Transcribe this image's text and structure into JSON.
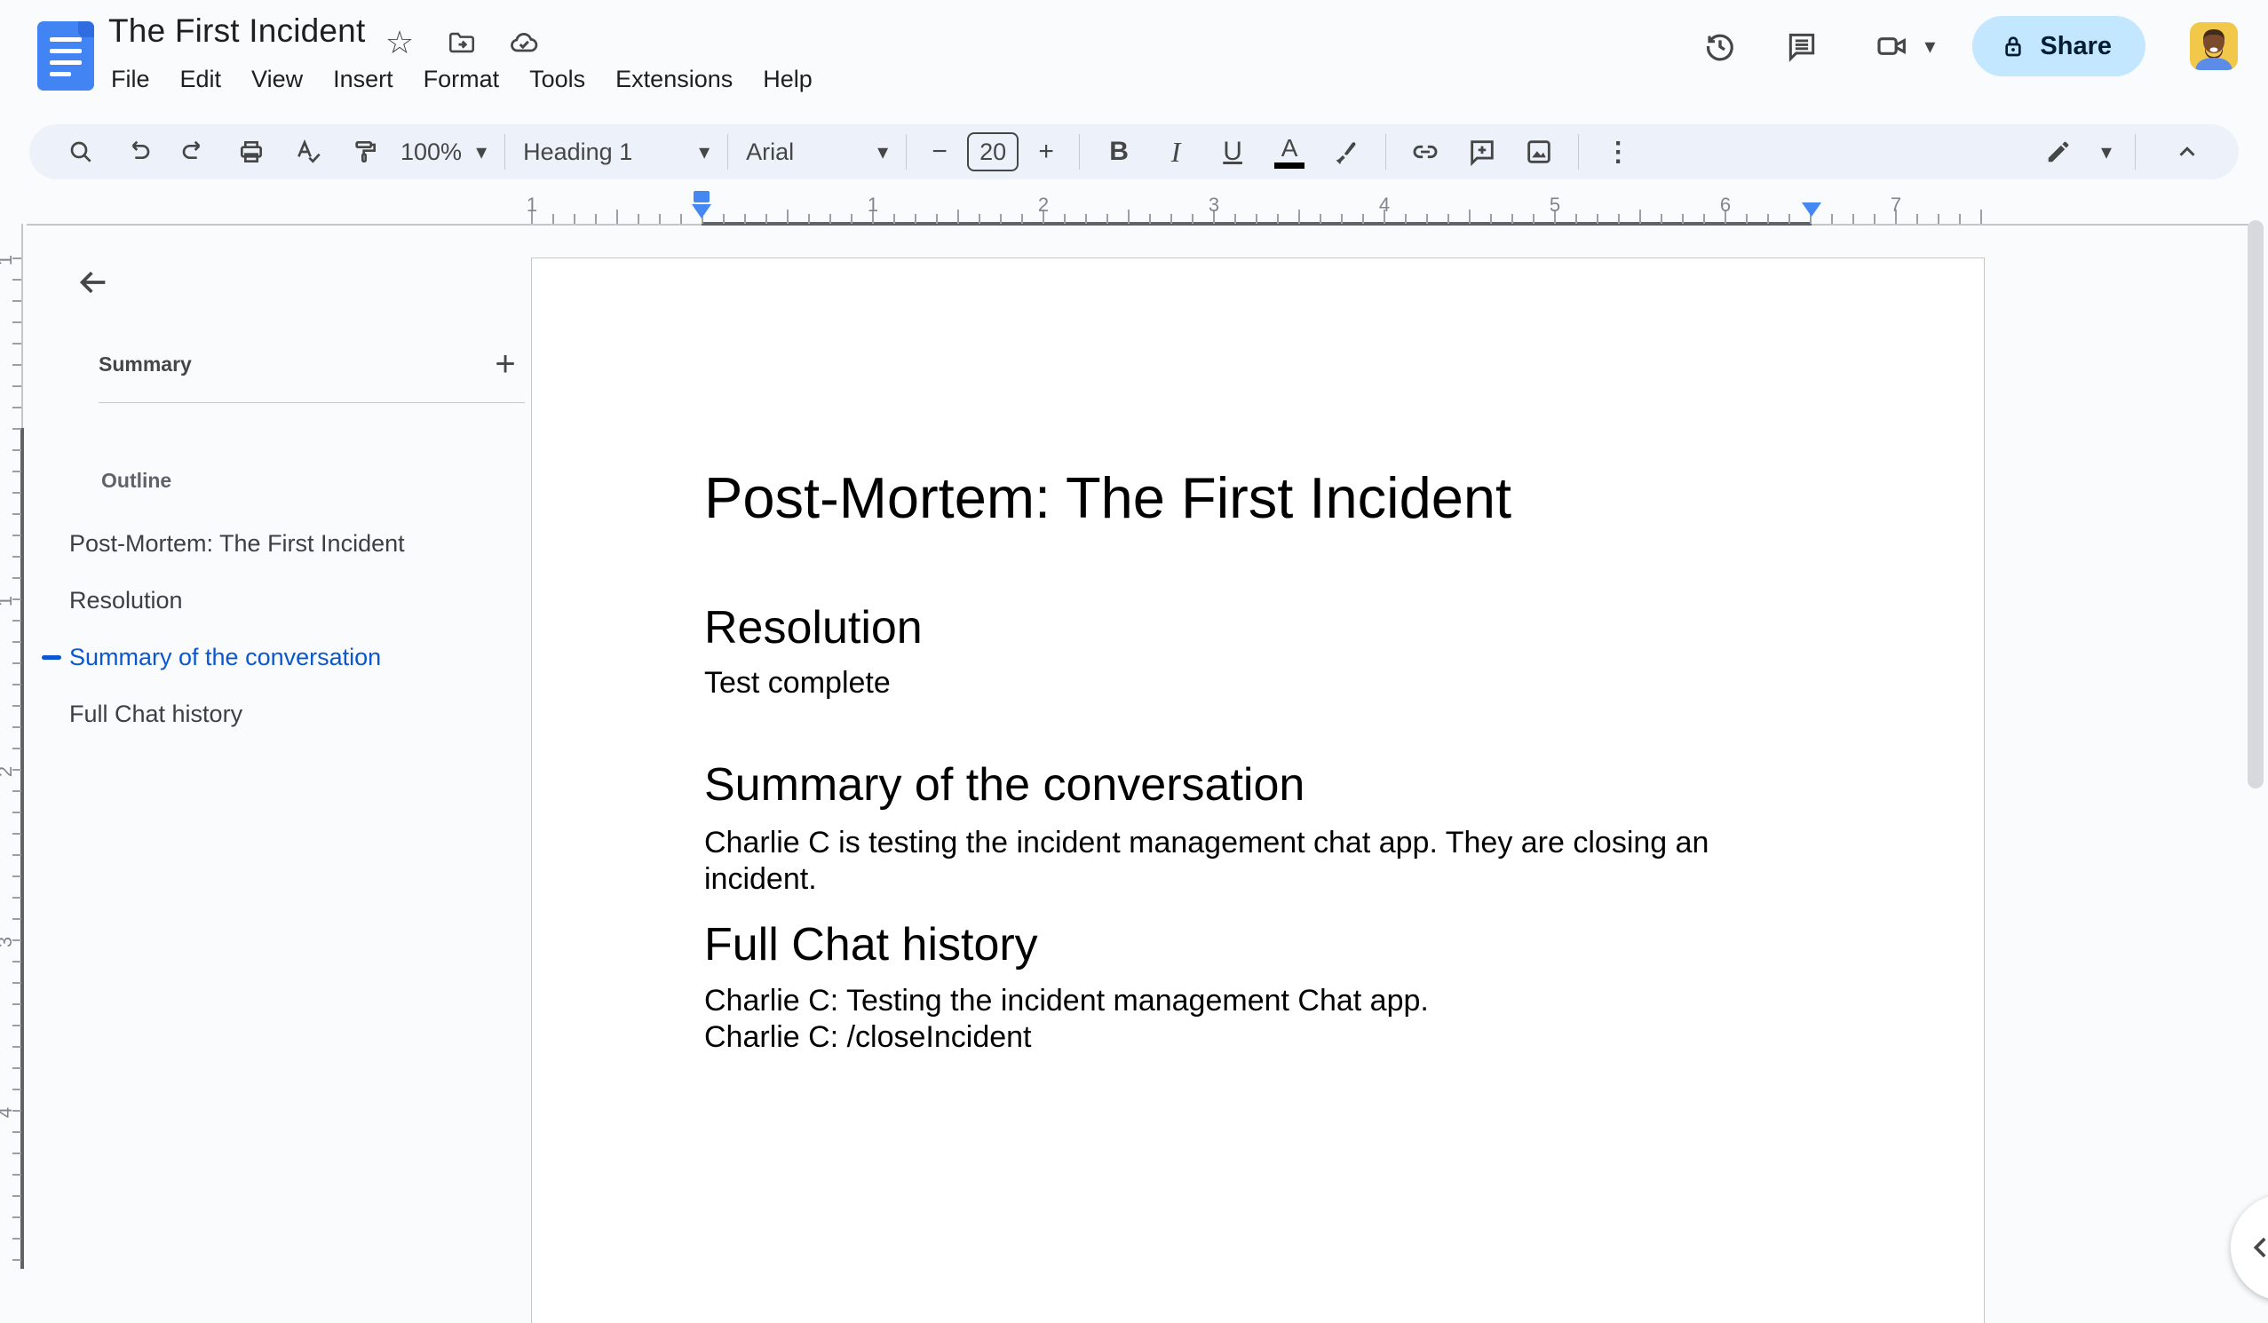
{
  "header": {
    "doc_title": "The First Incident",
    "menus": [
      "File",
      "Edit",
      "View",
      "Insert",
      "Format",
      "Tools",
      "Extensions",
      "Help"
    ],
    "share_label": "Share"
  },
  "toolbar": {
    "zoom_value": "100%",
    "style_value": "Heading 1",
    "font_value": "Arial",
    "font_size_value": "20"
  },
  "glyphs": {
    "caret": "▾",
    "star": "☆",
    "plus": "+",
    "minus": "−",
    "bold": "B",
    "italic": "I",
    "underline": "U",
    "text_color": "A",
    "more_vertical": "⋮"
  },
  "icons": [
    "docs-logo",
    "star-icon",
    "move-folder-icon",
    "cloud-check-icon",
    "history-icon",
    "comments-icon",
    "video-call-icon",
    "lock-icon",
    "search-icon",
    "undo-icon",
    "redo-icon",
    "print-icon",
    "spellcheck-icon",
    "paint-format-icon",
    "link-icon",
    "add-comment-icon",
    "insert-image-icon",
    "edit-mode-pencil-icon",
    "collapse-menus-icon",
    "back-arrow-icon",
    "chevron-left-icon"
  ],
  "sidebar": {
    "summary_label": "Summary",
    "outline_label": "Outline",
    "items": [
      {
        "label": "Post-Mortem: The First Incident",
        "active": false
      },
      {
        "label": "Resolution",
        "active": false
      },
      {
        "label": "Summary of the conversation",
        "active": true
      },
      {
        "label": "Full Chat history",
        "active": false
      }
    ]
  },
  "ruler": {
    "h_labels": [
      "1",
      "1",
      "2",
      "3",
      "4",
      "5",
      "6",
      "7"
    ],
    "v_labels": [
      "1",
      "1",
      "2",
      "3",
      "4"
    ]
  },
  "document": {
    "title": "Post-Mortem: The First Incident",
    "sections": [
      {
        "heading": "Resolution",
        "body": [
          "Test complete"
        ]
      },
      {
        "heading": "Summary of the conversation",
        "body": [
          "Charlie C is testing the incident management chat app. They are closing an incident."
        ]
      },
      {
        "heading": "Full Chat history",
        "body": [
          "Charlie C: Testing the incident management Chat app.",
          "Charlie C: /closeIncident"
        ]
      }
    ]
  },
  "colors": {
    "accent_blue": "#0b57d0",
    "share_bg": "#c2e7ff",
    "share_text": "#001d35",
    "toolbar_bg": "#edf2fa",
    "canvas_bg": "#f9fbfd",
    "icon": "#444746",
    "indent_marker": "#4688f1"
  }
}
